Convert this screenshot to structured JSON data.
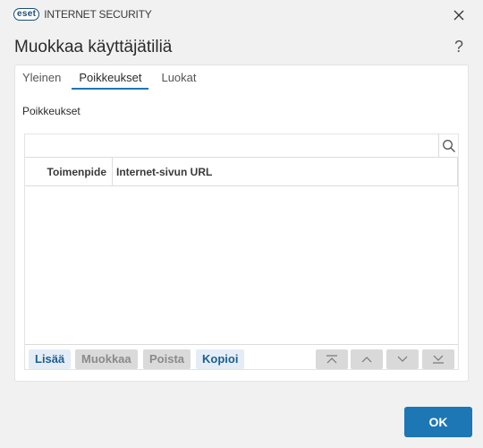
{
  "window": {
    "brand": "eset",
    "product": "INTERNET SECURITY",
    "close_icon": "close-icon"
  },
  "dialog": {
    "title": "Muokkaa käyttäjätiliä",
    "help": "?"
  },
  "tabs": [
    {
      "label": "Yleinen",
      "active": false
    },
    {
      "label": "Poikkeukset",
      "active": true
    },
    {
      "label": "Luokat",
      "active": false
    }
  ],
  "section": {
    "label": "Poikkeukset"
  },
  "search": {
    "value": "",
    "icon": "search-icon"
  },
  "table": {
    "columns": [
      "Toimenpide",
      "Internet-sivun URL"
    ],
    "rows": []
  },
  "toolbar": {
    "add_label": "Lisää",
    "edit_label": "Muokkaa",
    "delete_label": "Poista",
    "copy_label": "Kopioi",
    "move_icons": [
      "move-top-icon",
      "move-up-icon",
      "move-down-icon",
      "move-bottom-icon"
    ]
  },
  "footer": {
    "ok_label": "OK"
  },
  "colors": {
    "accent": "#1d77b5",
    "background": "#f1f1f1",
    "panel": "#ffffff",
    "disabled_button": "#dadada"
  }
}
